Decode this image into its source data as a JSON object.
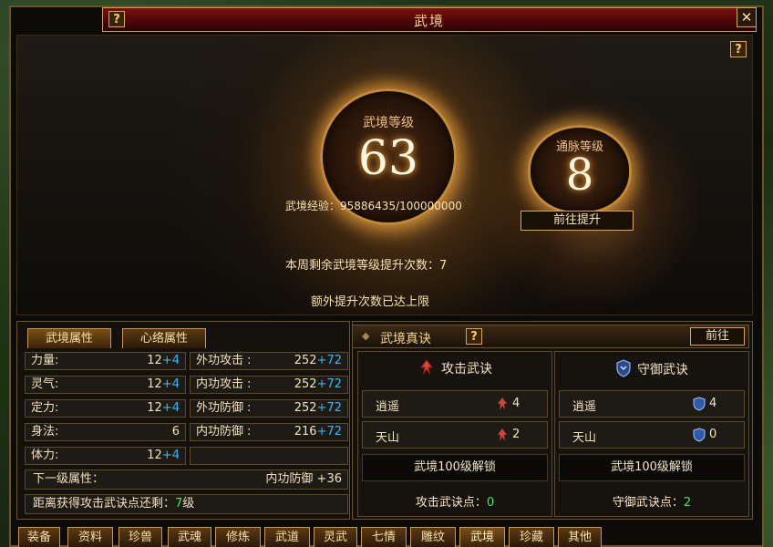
{
  "window": {
    "title": "武境",
    "close": "✕",
    "help": "?"
  },
  "hero": {
    "main_orb": {
      "label": "武境等级",
      "value": "63"
    },
    "side_orb": {
      "label": "通脉等级",
      "value": "8"
    },
    "exp_text": "武境经验：95886435/100000000",
    "goto_button": "前往提升",
    "weekly_text": "本周剩余武境等级提升次数：7",
    "extra_text": "额外提升次数已达上限"
  },
  "left_tabs": [
    "武境属性",
    "心络属性"
  ],
  "attrs_left": [
    {
      "name": "力量",
      "base": "12",
      "bonus": "+4"
    },
    {
      "name": "灵气",
      "base": "12",
      "bonus": "+4"
    },
    {
      "name": "定力",
      "base": "12",
      "bonus": "+4"
    },
    {
      "name": "身法",
      "base": "6",
      "bonus": ""
    },
    {
      "name": "体力",
      "base": "12",
      "bonus": "+4"
    }
  ],
  "attrs_right": [
    {
      "name": "外功攻击",
      "base": "252",
      "bonus": "+72"
    },
    {
      "name": "内功攻击",
      "base": "252",
      "bonus": "+72"
    },
    {
      "name": "外功防御",
      "base": "252",
      "bonus": "+72"
    },
    {
      "name": "内功防御",
      "base": "216",
      "bonus": "+72"
    }
  ],
  "next_level": {
    "label": "下一级属性：",
    "value": "内功防御 +36"
  },
  "distance": {
    "prefix": "距离获得攻击武诀点还剩：",
    "value": "7",
    "suffix": "级"
  },
  "right_panel": {
    "title": "武境真诀",
    "goto_button": "前往",
    "attack": {
      "title": "攻击武诀",
      "skills": [
        {
          "name": "逍遥",
          "value": "4"
        },
        {
          "name": "天山",
          "value": "2"
        }
      ],
      "unlock": "武境100级解锁",
      "points_label": "攻击武诀点：",
      "points": "0"
    },
    "defense": {
      "title": "守御武诀",
      "skills": [
        {
          "name": "逍遥",
          "value": "4"
        },
        {
          "name": "天山",
          "value": "0"
        }
      ],
      "unlock": "武境100级解锁",
      "points_label": "守御武诀点：",
      "points": "2"
    }
  },
  "bottom_tabs": [
    "装备",
    "资料",
    "珍兽",
    "武魂",
    "修炼",
    "武道",
    "灵武",
    "七情",
    "雕纹",
    "武境",
    "珍藏",
    "其他"
  ],
  "colors": {
    "accent": "#d9a84a",
    "bonus": "#35b8ff",
    "points_green": "#3ee65a"
  }
}
